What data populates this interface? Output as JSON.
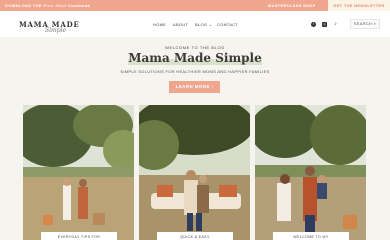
{
  "topbar": {
    "promo_prefix": "DOWNLOAD THE",
    "promo_italic": "Free Meal",
    "promo_suffix": "Cookbook",
    "links": [
      "MASTERCLASS",
      "SHOP",
      "ABOUT"
    ],
    "cta": "GET THE NEWSLETTER"
  },
  "header": {
    "logo_main": "MAMA MADE",
    "logo_script": "Simple",
    "nav": [
      "HOME",
      "ABOUT",
      "BLOG ⌄",
      "CONTACT"
    ],
    "social_icons": [
      "facebook-icon",
      "instagram-icon",
      "tiktok-icon"
    ],
    "search_label": "SEARCH",
    "search_icon": "magnifier-icon"
  },
  "hero": {
    "kicker": "WELCOME TO THE BLOG",
    "title": "Mama Made Simple",
    "subtitle": "SIMPLE SOLUTIONS FOR HEALTHIER MOMS AND HAPPIER FAMILIES",
    "button": "LEARN MORE ›"
  },
  "cards": [
    {
      "label": "EVERYDAY TIPS FOR"
    },
    {
      "label": "QUICK & EASY"
    },
    {
      "label": "WELCOME TO MY"
    }
  ],
  "colors": {
    "accent": "#f0a58f",
    "cream": "#fbf3e6",
    "highlight": "#d9e1cd",
    "background": "#f6f4ef"
  }
}
